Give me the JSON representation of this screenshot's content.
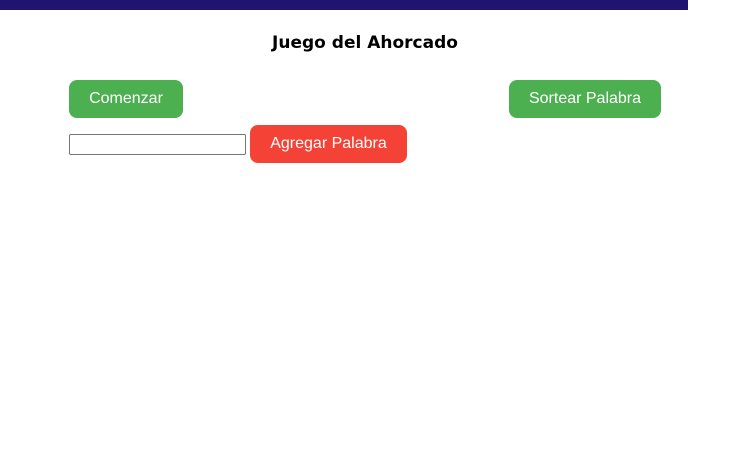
{
  "header": {
    "title": "Juego del Ahorcado",
    "bar_color": "#1f1470"
  },
  "controls": {
    "start_label": "Comenzar",
    "draw_label": "Sortear Palabra",
    "add_label": "Agregar Palabra",
    "word_input_value": "",
    "word_input_placeholder": ""
  },
  "colors": {
    "primary_button": "#4caf50",
    "danger_button": "#f44336"
  }
}
